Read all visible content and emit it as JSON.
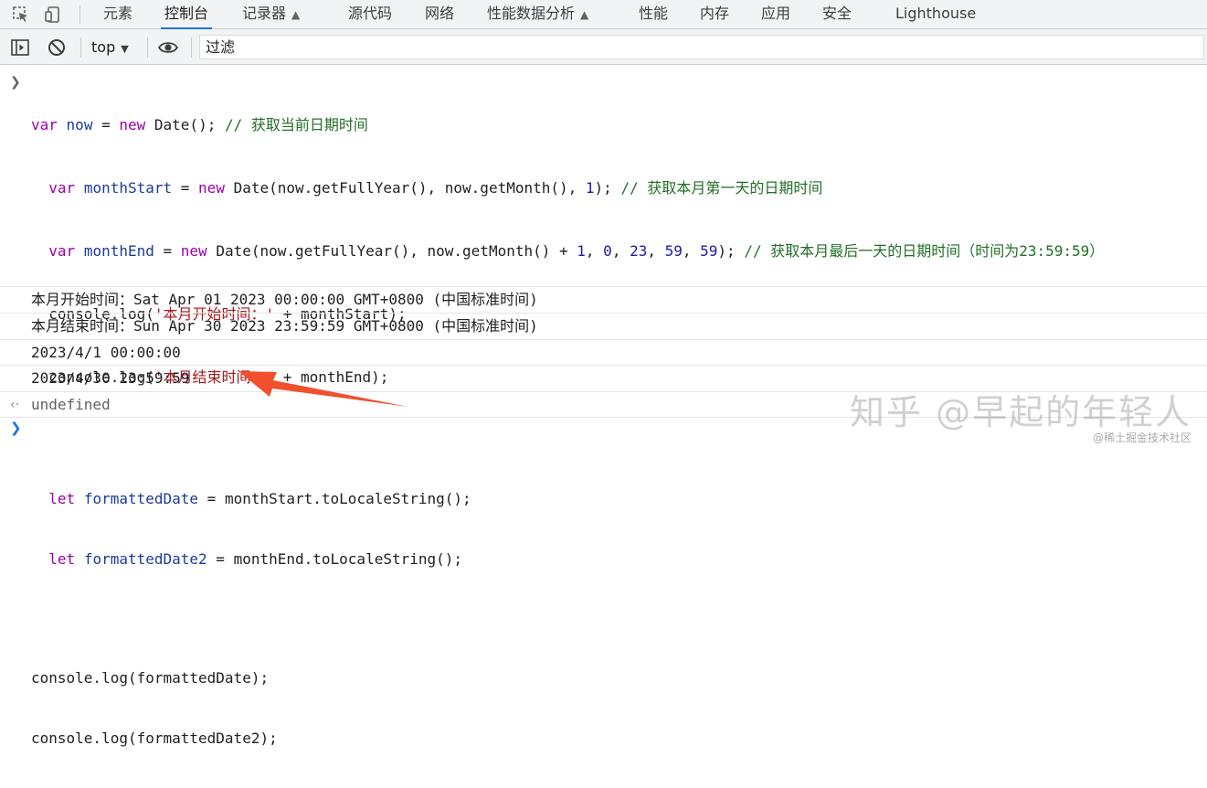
{
  "tabs": [
    {
      "label": "元素",
      "active": false,
      "experimental": false
    },
    {
      "label": "控制台",
      "active": true,
      "experimental": false
    },
    {
      "label": "记录器",
      "active": false,
      "experimental": true
    },
    {
      "label": "源代码",
      "active": false,
      "experimental": false
    },
    {
      "label": "网络",
      "active": false,
      "experimental": false
    },
    {
      "label": "性能数据分析",
      "active": false,
      "experimental": true
    },
    {
      "label": "性能",
      "active": false,
      "experimental": false
    },
    {
      "label": "内存",
      "active": false,
      "experimental": false
    },
    {
      "label": "应用",
      "active": false,
      "experimental": false
    },
    {
      "label": "安全",
      "active": false,
      "experimental": false
    },
    {
      "label": "Lighthouse",
      "active": false,
      "experimental": false
    }
  ],
  "toolbar": {
    "context": "top",
    "filter_placeholder": "过滤"
  },
  "input": {
    "lines": [
      "var now = new Date(); // 获取当前日期时间",
      "  var monthStart = new Date(now.getFullYear(), now.getMonth(), 1); // 获取本月第一天的日期时间",
      "  var monthEnd = new Date(now.getFullYear(), now.getMonth() + 1, 0, 23, 59, 59); // 获取本月最后一天的日期时间（时间为23:59:59）",
      "  console.log('本月开始时间：' + monthStart);",
      "  console.log('本月结束时间：' + monthEnd);",
      "",
      "  let formattedDate = monthStart.toLocaleString();",
      "  let formattedDate2 = monthEnd.toLocaleString();",
      "",
      "console.log(formattedDate);",
      "console.log(formattedDate2);"
    ]
  },
  "outputs": [
    "本月开始时间：Sat Apr 01 2023 00:00:00 GMT+0800 (中国标准时间)",
    "本月结束时间：Sun Apr 30 2023 23:59:59 GMT+0800 (中国标准时间)",
    "2023/4/1 00:00:00",
    "2023/4/30 23:59:59"
  ],
  "return_value": "undefined",
  "watermark": {
    "main": "知乎 @早起的年轻人",
    "sub": "@稀土掘金技术社区"
  },
  "colors": {
    "accent": "#1a73e8",
    "keyword": "#9a00a8",
    "variable": "#1d3b97",
    "string": "#a8171a",
    "number": "#1c1aa7",
    "comment": "#236e25",
    "annotation_arrow": "#f0502d"
  }
}
